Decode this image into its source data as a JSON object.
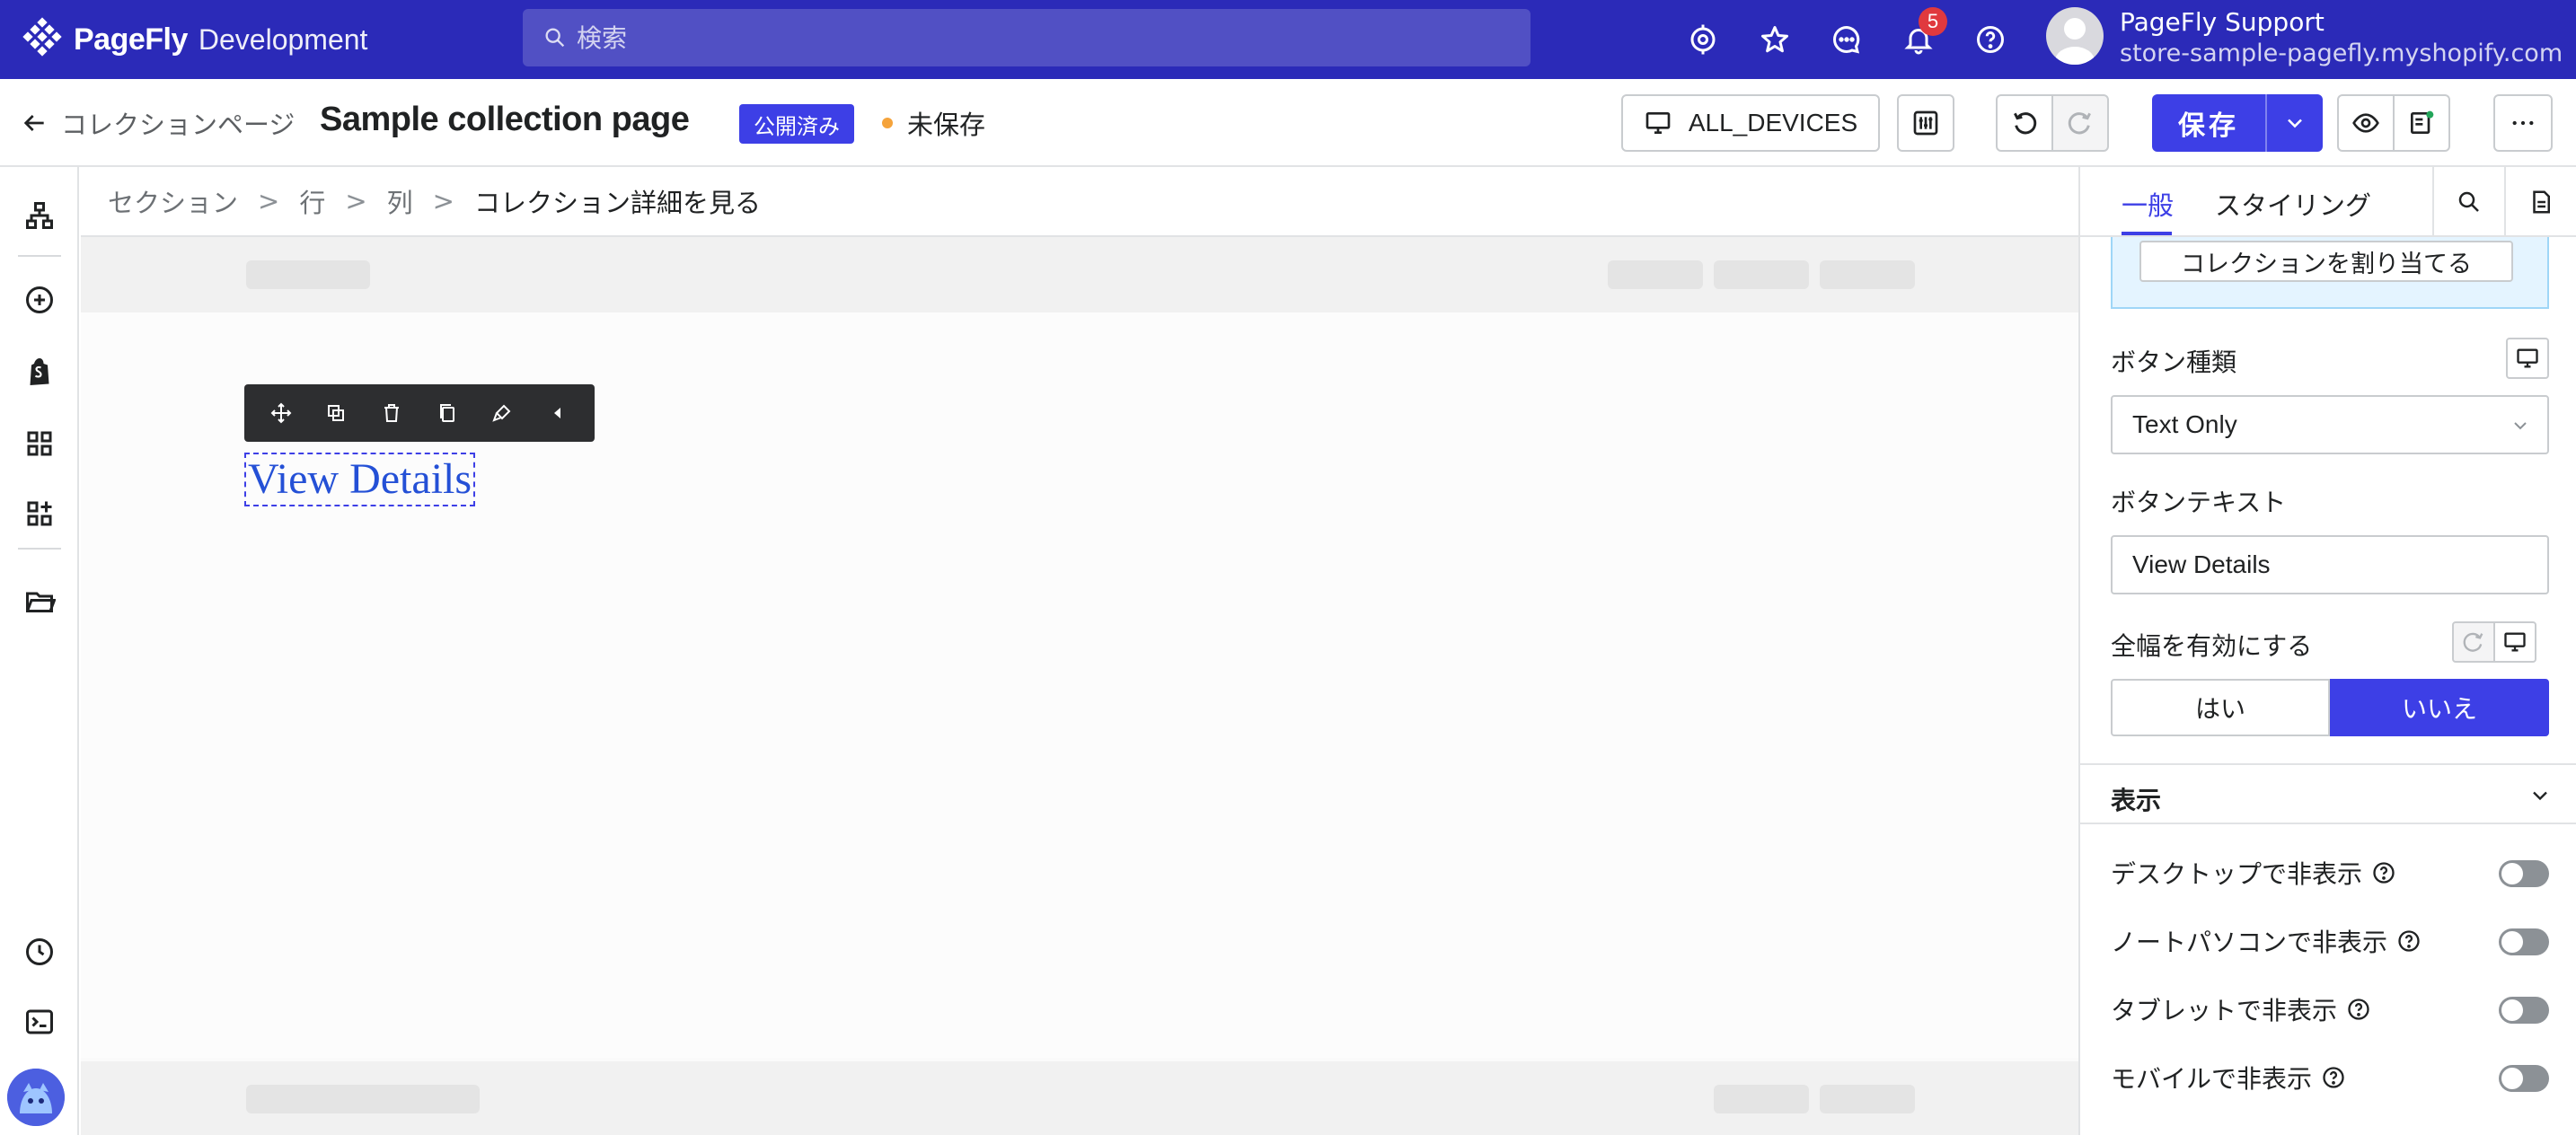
{
  "topbar": {
    "brand_name": "PageFly",
    "brand_sub": "Development",
    "search_placeholder": "検索",
    "notification_count": "5",
    "user_name": "PageFly Support",
    "user_store": "store-sample-pagefly.myshopify.com"
  },
  "toolbar": {
    "back_label": "コレクションページ",
    "page_title": "Sample collection page",
    "status_badge": "公開済み",
    "unsaved_label": "未保存",
    "devices_label": "ALL_DEVICES",
    "save_label": "保存"
  },
  "breadcrumb": {
    "items": [
      "セクション",
      "行",
      "列"
    ],
    "separator": ">",
    "current": "コレクション詳細を見る"
  },
  "canvas": {
    "selected_element_text": "View Details"
  },
  "panel": {
    "tabs": [
      "一般",
      "スタイリング"
    ],
    "active_tab": "一般",
    "assign_collection_label": "コレクションを割り当てる",
    "button_type_label": "ボタン種類",
    "button_type_value": "Text Only",
    "button_text_label": "ボタンテキスト",
    "button_text_value": "View Details",
    "full_width_label": "全幅を有効にする",
    "full_width_options": [
      "はい",
      "いいえ"
    ],
    "full_width_selected": "いいえ",
    "display_section_title": "表示",
    "visibility": [
      {
        "label": "デスクトップで非表示",
        "enabled": false
      },
      {
        "label": "ノートパソコンで非表示",
        "enabled": false
      },
      {
        "label": "タブレットで非表示",
        "enabled": false
      },
      {
        "label": "モバイルで非表示",
        "enabled": false
      }
    ]
  },
  "colors": {
    "topbar_bg": "#2b2ab8",
    "accent": "#3d3fe6",
    "unsaved_dot": "#f5a33b",
    "notification_badge": "#e0393e"
  }
}
